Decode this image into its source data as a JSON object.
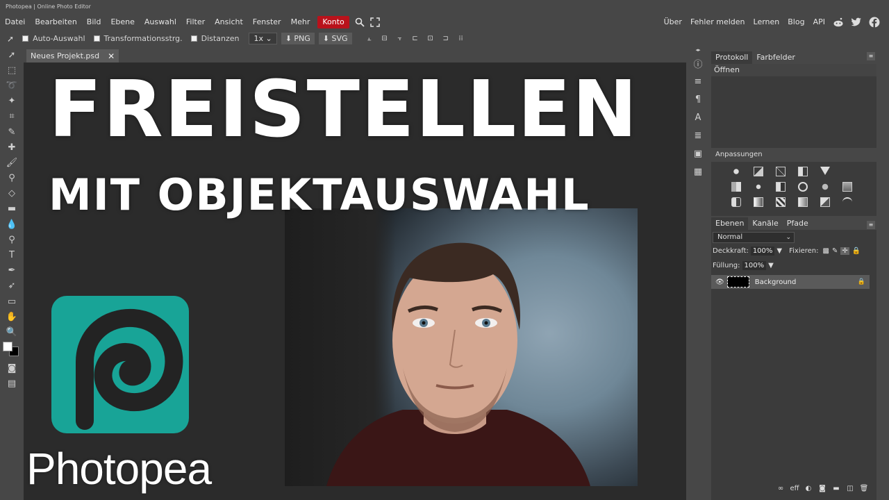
{
  "window": {
    "title": "Photopea | Online Photo Editor"
  },
  "menubar": {
    "items": [
      "Datei",
      "Bearbeiten",
      "Bild",
      "Ebene",
      "Auswahl",
      "Filter",
      "Ansicht",
      "Fenster",
      "Mehr"
    ],
    "account": "Konto",
    "right_links": [
      "Über",
      "Fehler melden",
      "Lernen",
      "Blog",
      "API"
    ]
  },
  "options": {
    "auto_select": "Auto-Auswahl",
    "transform_controls": "Transformationsstrg.",
    "distances": "Distanzen",
    "zoom": "1x",
    "export_png": "PNG",
    "export_svg": "SVG"
  },
  "document": {
    "tab_title": "Neues Projekt.psd",
    "headline": "FREISTELLEN",
    "subline": "MIT OBJEKTAUSWAHL",
    "brand": "Photopea"
  },
  "panels": {
    "history_tabs": [
      "Protokoll",
      "Farbfelder"
    ],
    "history_items": [
      "Öffnen"
    ],
    "adjustments_title": "Anpassungen",
    "layer_tabs": [
      "Ebenen",
      "Kanäle",
      "Pfade"
    ],
    "blend_mode": "Normal",
    "opacity_label": "Deckkraft:",
    "opacity_value": "100%",
    "lock_label": "Fixieren:",
    "fill_label": "Füllung:",
    "fill_value": "100%",
    "layers": [
      {
        "name": "Background"
      }
    ]
  },
  "colors": {
    "accent": "#b9121b",
    "brand_teal": "#18a497",
    "panel_bg": "#3b3b3b",
    "chrome_bg": "#474747"
  }
}
